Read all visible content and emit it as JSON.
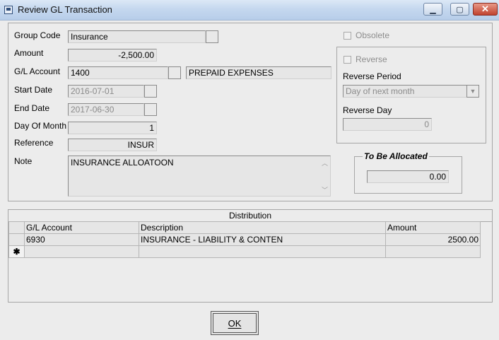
{
  "window": {
    "title": "Review GL Transaction"
  },
  "form": {
    "group_code_label": "Group Code",
    "group_code_value": "Insurance",
    "amount_label": "Amount",
    "amount_value": "-2,500.00",
    "gl_account_label": "G/L Account",
    "gl_account_value": "1400",
    "gl_account_desc": "PREPAID EXPENSES",
    "start_date_label": "Start Date",
    "start_date_value": "2016-07-01",
    "end_date_label": "End Date",
    "end_date_value": "2017-06-30",
    "day_of_month_label": "Day Of Month",
    "day_of_month_value": "1",
    "reference_label": "Reference",
    "reference_value": "INSUR",
    "note_label": "Note",
    "note_value": "INSURANCE ALLOATOON"
  },
  "options": {
    "obsolete_label": "Obsolete",
    "reverse_label": "Reverse",
    "reverse_period_label": "Reverse Period",
    "reverse_period_value": "Day of next month",
    "reverse_day_label": "Reverse Day",
    "reverse_day_value": "0"
  },
  "allocation": {
    "title": "To Be Allocated",
    "value": "0.00"
  },
  "distribution": {
    "title": "Distribution",
    "columns": [
      "G/L Account",
      "Description",
      "Amount"
    ],
    "rows": [
      {
        "account": "6930",
        "description": "INSURANCE - LIABILITY & CONTEN",
        "amount": "2500.00"
      }
    ],
    "new_row_marker": "✱"
  },
  "buttons": {
    "ok": "OK"
  }
}
